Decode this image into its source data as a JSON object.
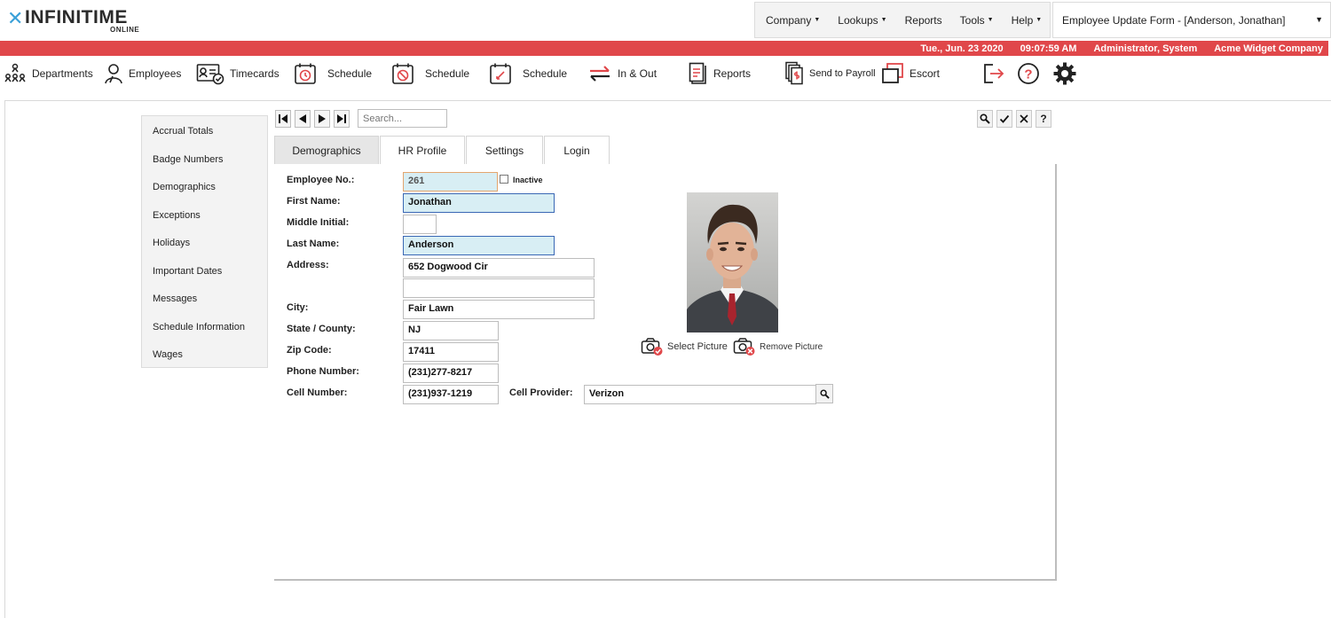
{
  "logo": {
    "text": "INFINITIME",
    "subtext": "ONLINE"
  },
  "menu": [
    {
      "label": "Company",
      "has_dropdown": true
    },
    {
      "label": "Lookups",
      "has_dropdown": true
    },
    {
      "label": "Reports",
      "has_dropdown": false
    },
    {
      "label": "Tools",
      "has_dropdown": true
    },
    {
      "label": "Help",
      "has_dropdown": true
    }
  ],
  "form_selector": {
    "value": "Employee Update Form - [Anderson, Jonathan]"
  },
  "status": {
    "date": "Tue., Jun. 23 2020",
    "time": "09:07:59 AM",
    "user": "Administrator, System",
    "company": "Acme Widget Company",
    "color": "#e0474a"
  },
  "toolbar": [
    {
      "label": "Departments",
      "icon": "departments-icon"
    },
    {
      "label": "Employees",
      "icon": "employees-icon"
    },
    {
      "label": "Timecards",
      "icon": "timecards-icon"
    },
    {
      "label": "Schedule",
      "icon": "schedule-clock-icon"
    },
    {
      "label": "Schedule",
      "icon": "schedule-cancel-icon"
    },
    {
      "label": "Schedule",
      "icon": "schedule-edit-icon"
    },
    {
      "label": "In & Out",
      "icon": "in-out-icon"
    },
    {
      "label": "Reports",
      "icon": "reports-icon"
    },
    {
      "label": "Send to Payroll",
      "icon": "send-payroll-icon"
    },
    {
      "label": "Escort",
      "icon": "escort-icon"
    },
    {
      "label": "",
      "icon": "logout-icon"
    },
    {
      "label": "",
      "icon": "help-icon"
    },
    {
      "label": "",
      "icon": "settings-icon"
    }
  ],
  "sidebar": {
    "items": [
      "Accrual Totals",
      "Badge Numbers",
      "Demographics",
      "Exceptions",
      "Holidays",
      "Important Dates",
      "Messages",
      "Schedule Information",
      "Wages"
    ]
  },
  "search": {
    "placeholder": "Search..."
  },
  "tabs": [
    {
      "label": "Demographics",
      "active": true
    },
    {
      "label": "HR Profile",
      "active": false
    },
    {
      "label": "Settings",
      "active": false
    },
    {
      "label": "Login",
      "active": false
    }
  ],
  "fields": {
    "employee_no": {
      "label": "Employee No.:",
      "value": "261"
    },
    "inactive": {
      "label": "Inactive",
      "checked": false
    },
    "first_name": {
      "label": "First Name:",
      "value": "Jonathan"
    },
    "middle_initial": {
      "label": "Middle Initial:",
      "value": ""
    },
    "last_name": {
      "label": "Last Name:",
      "value": "Anderson"
    },
    "address": {
      "label": "Address:",
      "line1": "652 Dogwood Cir",
      "line2": ""
    },
    "city": {
      "label": "City:",
      "value": "Fair Lawn"
    },
    "state": {
      "label": "State / County:",
      "value": "NJ"
    },
    "zip": {
      "label": "Zip Code:",
      "value": "17411"
    },
    "phone": {
      "label": "Phone Number:",
      "value": "(231)277-8217"
    },
    "cell": {
      "label": "Cell Number:",
      "value": "(231)937-1219"
    },
    "cell_provider": {
      "label": "Cell Provider:",
      "value": "Verizon"
    }
  },
  "picture": {
    "select_label": "Select Picture",
    "remove_label": "Remove Picture"
  }
}
